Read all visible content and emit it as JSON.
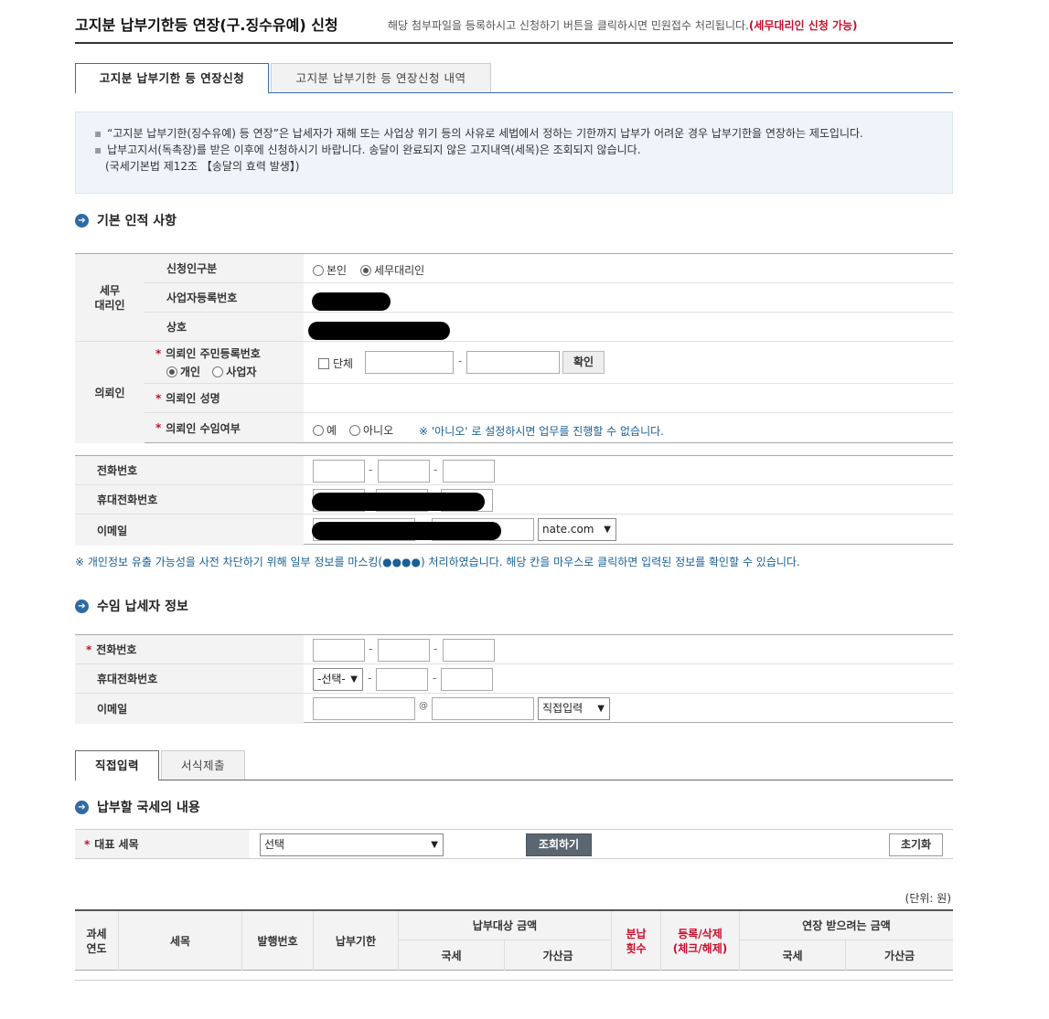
{
  "header": {
    "title": "고지분 납부기한등 연장(구.징수유예) 신청",
    "desc": "해당 첨부파일을 등록하시고 신청하기 버튼을 클릭하시면 민원접수 처리됩니다.",
    "desc_highlight": "(세무대리인 신청 가능)"
  },
  "tabs": [
    {
      "label": "고지분 납부기한 등 연장신청",
      "active": true
    },
    {
      "label": "고지분 납부기한 등 연장신청 내역",
      "active": false
    }
  ],
  "info": {
    "line1": "“고지분 납부기한(징수유예) 등 연장”은 납세자가 재해 또는 사업상 위기 등의 사유로 세법에서 정하는 기한까지 납부가 어려운 경우 납부기한을 연장하는 제도입니다.",
    "line2": "납부고지서(독촉장)를 받은 이후에 신청하시기 바랍니다. 송달이 완료되지 않은 고지내역(세목)은 조회되지 않습니다.",
    "line3": "(국세기본법 제12조 【송달의 효력 발생】)"
  },
  "section_basic": "기본 인적 사항",
  "agent": {
    "group": "세무\n대리인",
    "applicant_type": "신청인구분",
    "opt_self": "본인",
    "opt_agent": "세무대리인",
    "bizno": "사업자등록번호",
    "company": "상호"
  },
  "client": {
    "group": "의뢰인",
    "rrn_label": "의뢰인 주민등록번호",
    "opt_individual": "개인",
    "opt_business": "사업자",
    "group_chk": "단체",
    "confirm": "확인",
    "name_label": "의뢰인 성명",
    "accept_label": "의뢰인 수임여부",
    "opt_yes": "예",
    "opt_no": "아니오",
    "accept_note": "※ '아니오' 로 설정하시면 업무를 진행할 수 없습니다."
  },
  "contact": {
    "phone": "전화번호",
    "mobile": "휴대전화번호",
    "email": "이메일",
    "email_domain": "nate.com"
  },
  "mask_note": "※ 개인정보 유출 가능성을 사전 차단하기 위해 일부 정보를 마스킹(●●●●) 처리하였습니다. 해당 칸을 마우스로 클릭하면 입력된 정보를 확인할 수 있습니다.",
  "section_taxpayer": "수임 납세자 정보",
  "taxpayer": {
    "phone": "전화번호",
    "mobile": "휴대전화번호",
    "mobile_select": "-선택-",
    "email": "이메일",
    "at": "@",
    "email_select": "직접입력"
  },
  "input_tabs": [
    {
      "label": "직접입력",
      "active": true
    },
    {
      "label": "서식제출",
      "active": false
    }
  ],
  "section_tax": "납부할 국세의 내용",
  "tax": {
    "label": "대표 세목",
    "select": "선택",
    "search": "조회하기",
    "reset": "초기화"
  },
  "unit": "(단위: 원)",
  "result_table": {
    "year": "과세\n연도",
    "item": "세목",
    "issue_no": "발행번호",
    "due": "납부기한",
    "target": "납부대상 금액",
    "tax": "국세",
    "surcharge": "가산금",
    "install": "분납\n횟수",
    "register": "등록/삭제\n(체크/해제)",
    "extend": "연장 받으려는 금액",
    "tax2": "국세",
    "surcharge2": "가산금"
  },
  "colors": {
    "accent": "#2f6ba3",
    "required": "#c8102e"
  }
}
